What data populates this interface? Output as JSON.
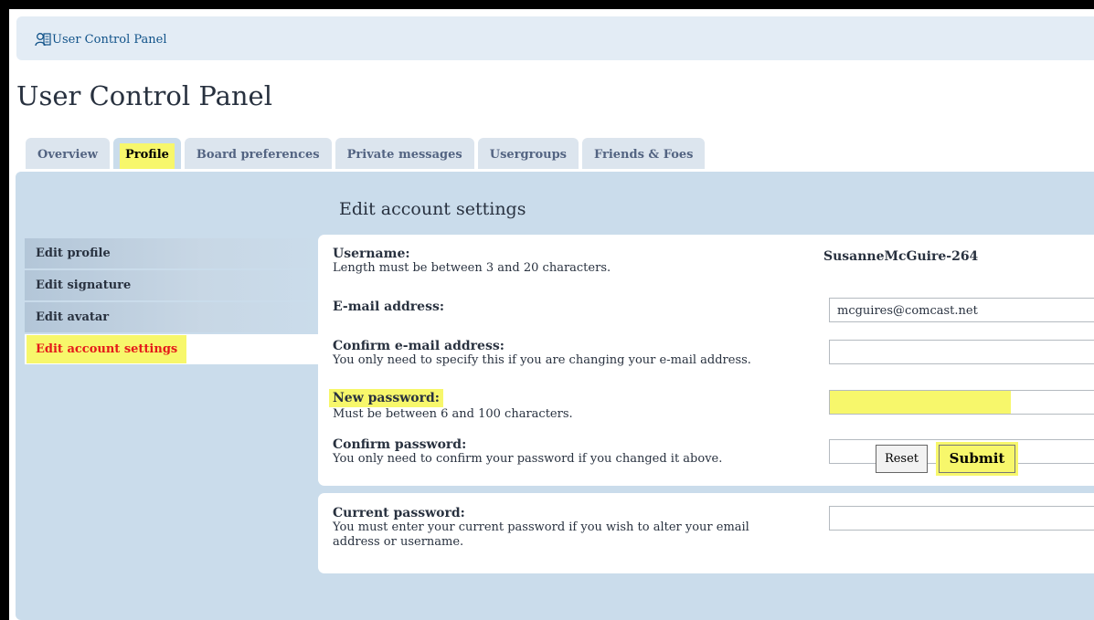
{
  "breadcrumb": {
    "label": "User Control Panel"
  },
  "page_title": "User Control Panel",
  "tabs": [
    {
      "label": "Overview",
      "active": false
    },
    {
      "label": "Profile",
      "active": true
    },
    {
      "label": "Board preferences",
      "active": false
    },
    {
      "label": "Private messages",
      "active": false
    },
    {
      "label": "Usergroups",
      "active": false
    },
    {
      "label": "Friends & Foes",
      "active": false
    }
  ],
  "side_menu": [
    {
      "label": "Edit profile"
    },
    {
      "label": "Edit signature"
    },
    {
      "label": "Edit avatar"
    },
    {
      "label": "Edit account settings",
      "active": true
    }
  ],
  "section_title": "Edit account settings",
  "form": {
    "username": {
      "label": "Username:",
      "hint": "Length must be between 3 and 20 characters.",
      "value": "SusanneMcGuire-264"
    },
    "email": {
      "label": "E-mail address:",
      "value": "mcguires@comcast.net"
    },
    "confirm_email": {
      "label": "Confirm e-mail address:",
      "hint": "You only need to specify this if you are changing your e-mail address.",
      "value": ""
    },
    "new_password": {
      "label": "New password:",
      "hint": "Must be between 6 and 100 characters.",
      "value": ""
    },
    "confirm_password": {
      "label": "Confirm password:",
      "hint": "You only need to confirm your password if you changed it above.",
      "value": ""
    },
    "current_password": {
      "label": "Current password:",
      "hint": "You must enter your current password if you wish to alter your email address or username.",
      "value": ""
    }
  },
  "buttons": {
    "reset": "Reset",
    "submit": "Submit"
  },
  "colors": {
    "highlight": "#f7f76b",
    "panel": "#cadceb",
    "active_menu_text": "#e51a1a",
    "link": "#105289"
  },
  "icons": {
    "breadcrumb": "user-panel-icon"
  }
}
